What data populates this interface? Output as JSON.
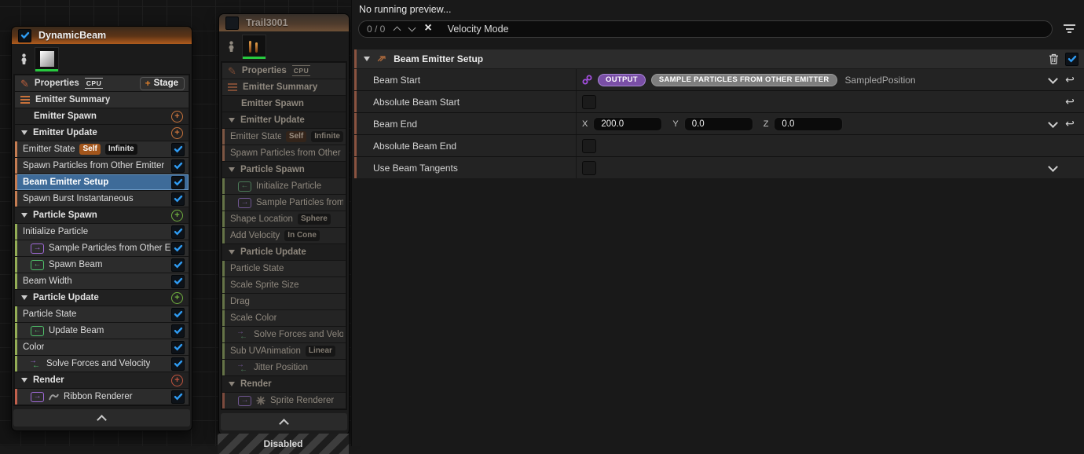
{
  "colors": {
    "selection_blue": "#3e6b99",
    "check_blue": "#2f9bf2",
    "header_gradient_orange": "#b05c1d",
    "accent_orange": "#c57c52",
    "accent_green": "#93ad55",
    "accent_salmon": "#c2604d",
    "plus_orange": "#c8733c",
    "plus_green": "#6fae3f",
    "plus_red": "#c1543f",
    "pill_purple": "#7a4fa6",
    "pill_gray": "#7e7e7e",
    "link_purple": "#a44fe0",
    "self_badge_orange": "#a3561c"
  },
  "top_bar": {
    "preview_text": "No running preview...",
    "search_count": "0 / 0",
    "search_query": "Velocity Mode"
  },
  "left_emitter": {
    "title": "DynamicBeam",
    "checked": true,
    "rows": [
      {
        "t": "properties",
        "label": "Properties",
        "cpu": "CPU",
        "stage_plus": "+",
        "stage_label": "Stage"
      },
      {
        "t": "summary",
        "label": "Emitter Summary"
      },
      {
        "t": "group",
        "label": "Emitter Spawn",
        "plus": "orange",
        "triangle": false
      },
      {
        "t": "group",
        "label": "Emitter Update",
        "plus": "orange",
        "triangle": true
      },
      {
        "t": "item",
        "label": "Emitter State",
        "accent": "orange",
        "check": true,
        "badges": [
          {
            "text": "Self",
            "style": "orange"
          },
          {
            "text": "Infinite",
            "style": "dark"
          }
        ]
      },
      {
        "t": "item",
        "label": "Spawn Particles from Other Emitter",
        "accent": "orange",
        "check": true
      },
      {
        "t": "item",
        "label": "Beam Emitter Setup",
        "accent": "orange",
        "check": true,
        "selected": true
      },
      {
        "t": "item",
        "label": "Spawn Burst Instantaneous",
        "accent": "orange",
        "check": true
      },
      {
        "t": "group",
        "label": "Particle Spawn",
        "plus": "green",
        "triangle": true
      },
      {
        "t": "item",
        "label": "Initialize Particle",
        "accent": "green",
        "check": true
      },
      {
        "t": "item",
        "label": "Sample Particles from Other Emitter",
        "accent": "green",
        "check": true,
        "icon": "purple-arrow"
      },
      {
        "t": "item",
        "label": "Spawn Beam",
        "accent": "green",
        "check": true,
        "icon": "green-arrow"
      },
      {
        "t": "item",
        "label": "Beam Width",
        "accent": "green",
        "check": true
      },
      {
        "t": "group",
        "label": "Particle Update",
        "plus": "green",
        "triangle": true
      },
      {
        "t": "item",
        "label": "Particle State",
        "accent": "green",
        "check": true
      },
      {
        "t": "item",
        "label": "Update Beam",
        "accent": "green",
        "check": true,
        "icon": "green-arrow"
      },
      {
        "t": "item",
        "label": "Color",
        "accent": "green",
        "check": true
      },
      {
        "t": "item",
        "label": "Solve Forces and Velocity",
        "accent": "green",
        "check": true,
        "icon": "double-arrow"
      },
      {
        "t": "group",
        "label": "Render",
        "plus": "red",
        "triangle": true
      },
      {
        "t": "item",
        "label": "Ribbon Renderer",
        "accent": "salmon",
        "check": true,
        "icon": "purple-arrow",
        "icon2": "ribbon"
      }
    ]
  },
  "middle_emitter": {
    "title": "Trail3001",
    "checked": false,
    "muted": true,
    "disabled_label": "Disabled",
    "rows": [
      {
        "t": "properties",
        "label": "Properties",
        "cpu": "CPU"
      },
      {
        "t": "summary",
        "label": "Emitter Summary"
      },
      {
        "t": "group",
        "label": "Emitter Spawn",
        "triangle": false
      },
      {
        "t": "group",
        "label": "Emitter Update",
        "triangle": true
      },
      {
        "t": "item",
        "label": "Emitter State",
        "accent": "orange",
        "badges": [
          {
            "text": "Self",
            "style": "orange"
          },
          {
            "text": "Infinite",
            "style": "dark"
          }
        ]
      },
      {
        "t": "item",
        "label": "Spawn Particles from Other Emitter",
        "accent": "orange"
      },
      {
        "t": "group",
        "label": "Particle Spawn",
        "triangle": true
      },
      {
        "t": "item",
        "label": "Initialize Particle",
        "accent": "green",
        "icon": "green-arrow"
      },
      {
        "t": "item",
        "label": "Sample Particles from Other Emitter",
        "accent": "green",
        "icon": "purple-arrow"
      },
      {
        "t": "item",
        "label": "Shape Location",
        "accent": "green",
        "badges": [
          {
            "text": "Sphere",
            "style": "dark"
          }
        ]
      },
      {
        "t": "item",
        "label": "Add Velocity",
        "accent": "green",
        "badges": [
          {
            "text": "In Cone",
            "style": "dark"
          }
        ]
      },
      {
        "t": "group",
        "label": "Particle Update",
        "triangle": true
      },
      {
        "t": "item",
        "label": "Particle State",
        "accent": "green"
      },
      {
        "t": "item",
        "label": "Scale Sprite Size",
        "accent": "green"
      },
      {
        "t": "item",
        "label": "Drag",
        "accent": "green"
      },
      {
        "t": "item",
        "label": "Scale Color",
        "accent": "green"
      },
      {
        "t": "item",
        "label": "Solve Forces and Velocity",
        "accent": "green",
        "icon": "double-arrow"
      },
      {
        "t": "item",
        "label": "Sub UVAnimation",
        "accent": "green",
        "badges": [
          {
            "text": "Linear",
            "style": "dark"
          }
        ]
      },
      {
        "t": "item",
        "label": "Jitter Position",
        "accent": "green",
        "icon": "double-arrow"
      },
      {
        "t": "group",
        "label": "Render",
        "triangle": true
      },
      {
        "t": "item",
        "label": "Sprite Renderer",
        "accent": "salmon",
        "icon": "purple-arrow",
        "icon2": "sprite"
      }
    ]
  },
  "details": {
    "title": "Beam Emitter Setup",
    "rows": [
      {
        "label": "Beam Start",
        "type": "linked",
        "pills": [
          {
            "text": "OUTPUT",
            "style": "purple"
          },
          {
            "text": "SAMPLE PARTICLES FROM OTHER EMITTER",
            "style": "gray"
          }
        ],
        "value": "SampledPosition",
        "chevron": true,
        "reset": true
      },
      {
        "label": "Absolute Beam Start",
        "type": "checkbox",
        "reset": true
      },
      {
        "label": "Beam End",
        "type": "vector",
        "fields": [
          {
            "axis": "X",
            "value": "200.0"
          },
          {
            "axis": "Y",
            "value": "0.0"
          },
          {
            "axis": "Z",
            "value": "0.0"
          }
        ],
        "chevron": true,
        "reset": true
      },
      {
        "label": "Absolute Beam End",
        "type": "checkbox"
      },
      {
        "label": "Use Beam Tangents",
        "type": "checkbox",
        "chevron": true
      }
    ]
  }
}
